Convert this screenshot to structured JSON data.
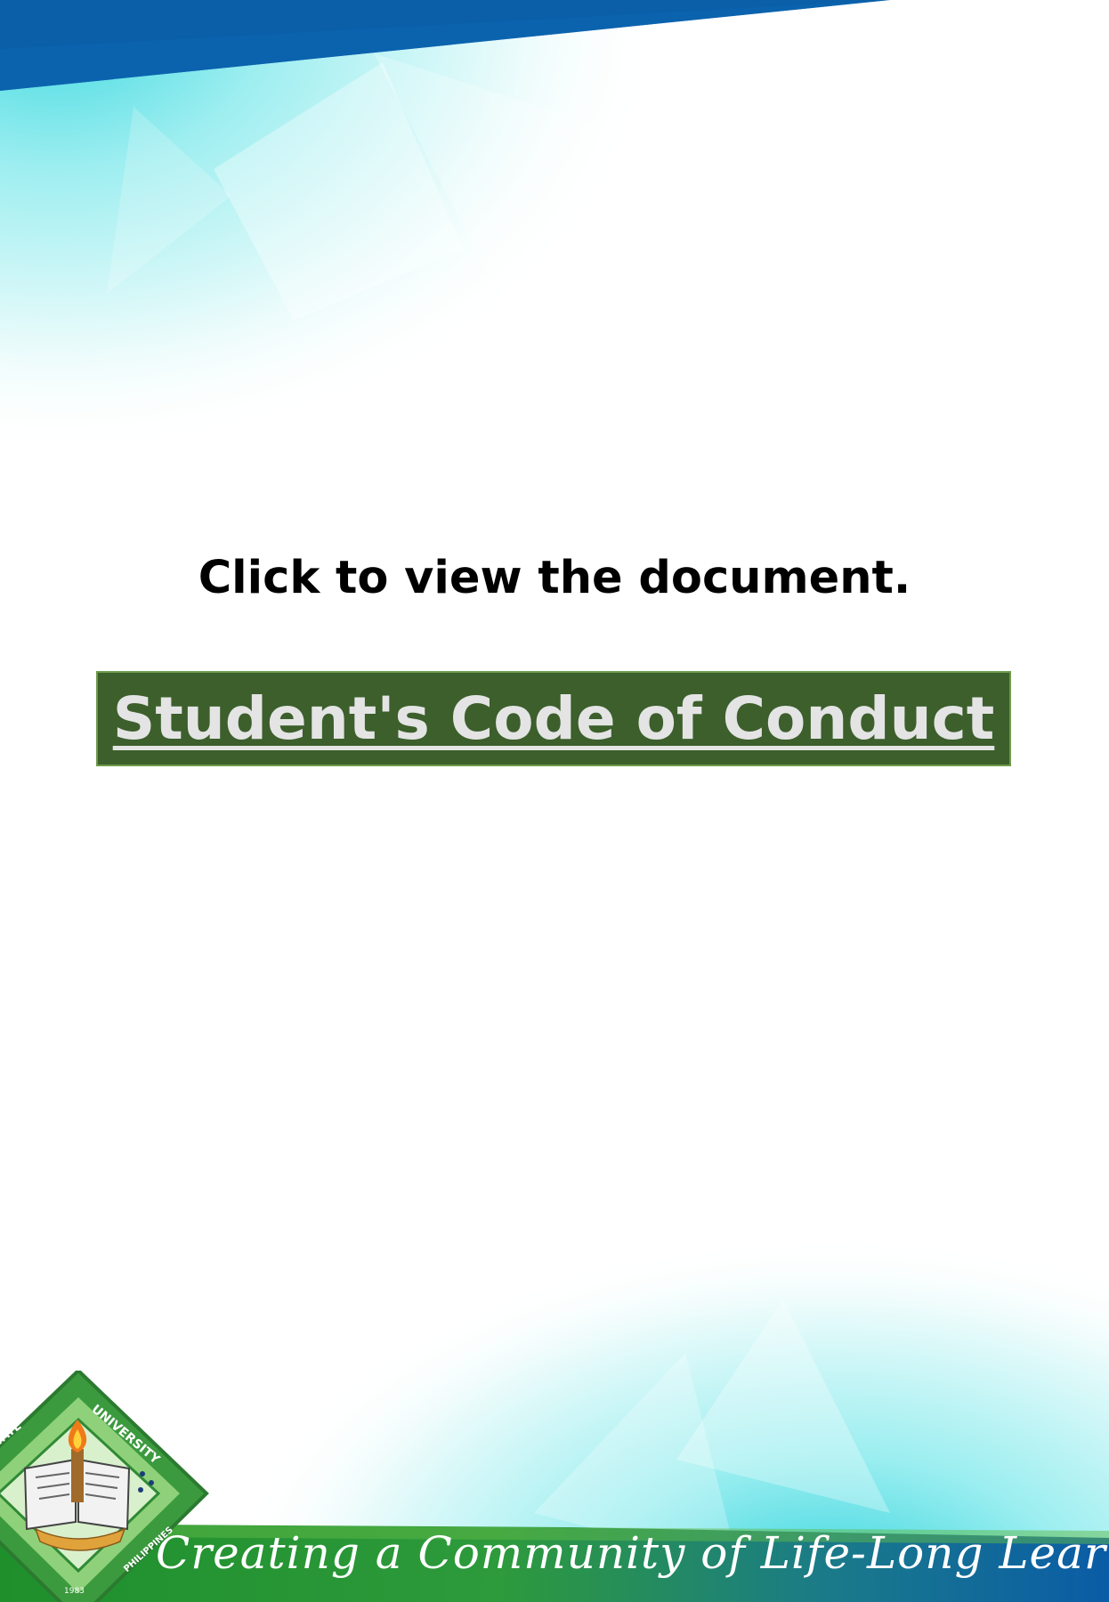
{
  "prompt": "Click to view the document.",
  "document_link": {
    "label": "Student's Code of Conduct"
  },
  "footer": {
    "tagline": "Creating a Community of Life-Long Learners"
  },
  "seal": {
    "text_top": "UNIVERSITY",
    "text_left": "STATE",
    "text_right": "PHILIPPINES",
    "year": "1983"
  },
  "colors": {
    "top_band": "#0a5fa8",
    "cyan": "#3fd9e0",
    "link_bg": "#3c5f2c",
    "link_text": "#e4e4e4",
    "bottom_green": "#2f9e3a",
    "bottom_blue": "#0a5ca6"
  }
}
